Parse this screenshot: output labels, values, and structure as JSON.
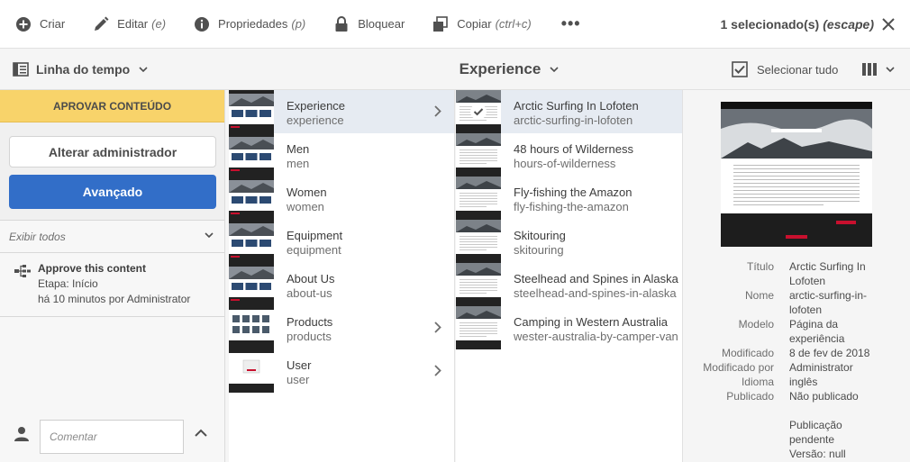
{
  "toolbar": {
    "create": "Criar",
    "edit": "Editar",
    "edit_hint": "(e)",
    "properties": "Propriedades",
    "properties_hint": "(p)",
    "lock": "Bloquear",
    "copy": "Copiar",
    "copy_hint": "(ctrl+c)",
    "more": "•••",
    "selection": "1 selecionado(s)",
    "selection_hint": "(escape)"
  },
  "subbar": {
    "rail_label": "Linha do tempo",
    "title": "Experience",
    "select_all": "Selecionar tudo"
  },
  "rail": {
    "approve_label": "APROVAR CONTEÚDO",
    "change_admin": "Alterar administrador",
    "advance": "Avançado",
    "filter": "Exibir todos",
    "workflow": {
      "title": "Approve this content",
      "step": "Etapa: Início",
      "meta": "há 10 minutos por Administrator"
    },
    "comment_placeholder": "Comentar"
  },
  "column1": [
    {
      "title": "Experience",
      "name": "experience",
      "has_children": true,
      "selected": true
    },
    {
      "title": "Men",
      "name": "men",
      "has_children": false
    },
    {
      "title": "Women",
      "name": "women",
      "has_children": false
    },
    {
      "title": "Equipment",
      "name": "equipment",
      "has_children": false
    },
    {
      "title": "About Us",
      "name": "about-us",
      "has_children": false
    },
    {
      "title": "Products",
      "name": "products",
      "has_children": true
    },
    {
      "title": "User",
      "name": "user",
      "has_children": true
    }
  ],
  "column2": [
    {
      "title": "Arctic Surfing In Lofoten",
      "name": "arctic-surfing-in-lofoten",
      "selected": true
    },
    {
      "title": "48 hours of Wilderness",
      "name": "hours-of-wilderness"
    },
    {
      "title": "Fly-fishing the Amazon",
      "name": "fly-fishing-the-amazon"
    },
    {
      "title": "Skitouring",
      "name": "skitouring"
    },
    {
      "title": "Steelhead and Spines in Alaska",
      "name": "steelhead-and-spines-in-alaska"
    },
    {
      "title": "Camping in Western Australia",
      "name": "wester-australia-by-camper-van"
    }
  ],
  "preview": {
    "rows": [
      {
        "k": "Título",
        "v": "Arctic Surfing In Lofoten"
      },
      {
        "k": "Nome",
        "v": "arctic-surfing-in-lofoten"
      },
      {
        "k": "Modelo",
        "v": "Página da experiência"
      },
      {
        "k": "Modificado",
        "v": "8 de fev de 2018"
      },
      {
        "k": "Modificado por",
        "v": "Administrator"
      },
      {
        "k": "Idioma",
        "v": "inglês"
      },
      {
        "k": "Publicado",
        "v": "Não publicado"
      },
      {
        "k": "",
        "v": ""
      },
      {
        "k": "",
        "v": "Publicação pendente"
      },
      {
        "k": "",
        "v": "Versão: null"
      }
    ]
  },
  "colors": {
    "accent": "#326ec8",
    "approve": "#f8d36a",
    "selected_row": "#e6ebf2"
  }
}
